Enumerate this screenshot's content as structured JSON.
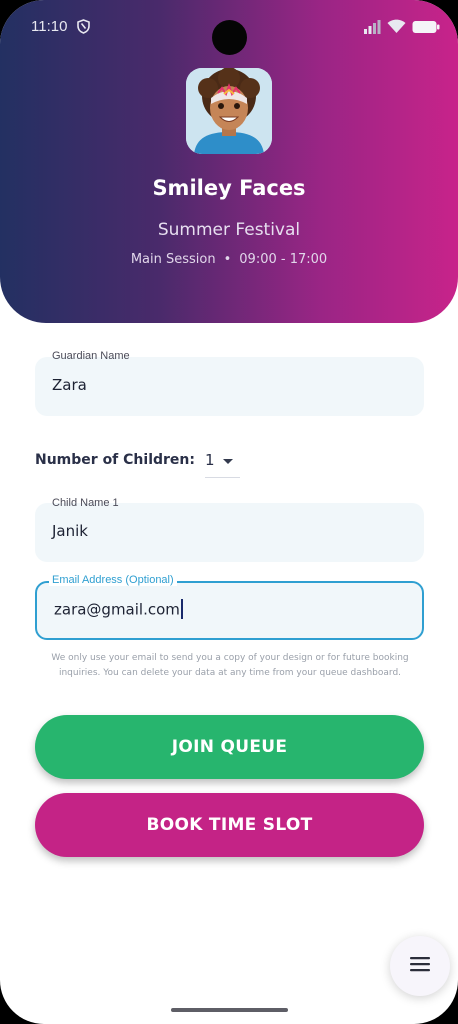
{
  "status": {
    "time": "11:10"
  },
  "header": {
    "title": "Smiley Faces",
    "event_name": "Summer Festival",
    "session_name": "Main Session",
    "separator": "•",
    "session_time": "09:00 - 17:00"
  },
  "form": {
    "guardian": {
      "label": "Guardian Name",
      "value": "Zara"
    },
    "children_count": {
      "label": "Number of Children:",
      "value": "1"
    },
    "child_name": {
      "label": "Child Name 1",
      "value": "Janik"
    },
    "email": {
      "label": "Email Address (Optional)",
      "value": "zara@gmail.com"
    },
    "privacy_note": "We only use your email to send you a copy of your design or for future booking inquiries. You can delete your data at any time from your queue dashboard."
  },
  "actions": {
    "join_label": "JOIN QUEUE",
    "book_label": "BOOK TIME SLOT"
  },
  "colors": {
    "join": "#27b56e",
    "book": "#c42386",
    "focus": "#2f9fd1"
  },
  "icons": [
    "shield-icon",
    "signal-icon",
    "wifi-icon",
    "battery-icon",
    "menu-icon"
  ]
}
